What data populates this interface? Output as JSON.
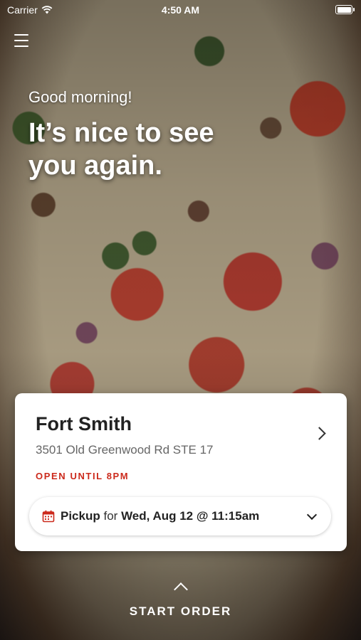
{
  "status_bar": {
    "carrier": "Carrier",
    "time": "4:50 AM"
  },
  "hero": {
    "greeting": "Good morning!",
    "headline": "It’s nice to see you again."
  },
  "store_card": {
    "name": "Fort Smith",
    "address": "3501 Old Greenwood Rd STE 17",
    "hours": "OPEN UNTIL 8PM",
    "pickup": {
      "mode": "Pickup",
      "connector": "for",
      "datetime": "Wed, Aug 12 @ 11:15am"
    }
  },
  "footer": {
    "start_order_label": "START ORDER"
  },
  "colors": {
    "accent_red": "#cc2a1c",
    "card_bg": "#ffffff"
  }
}
